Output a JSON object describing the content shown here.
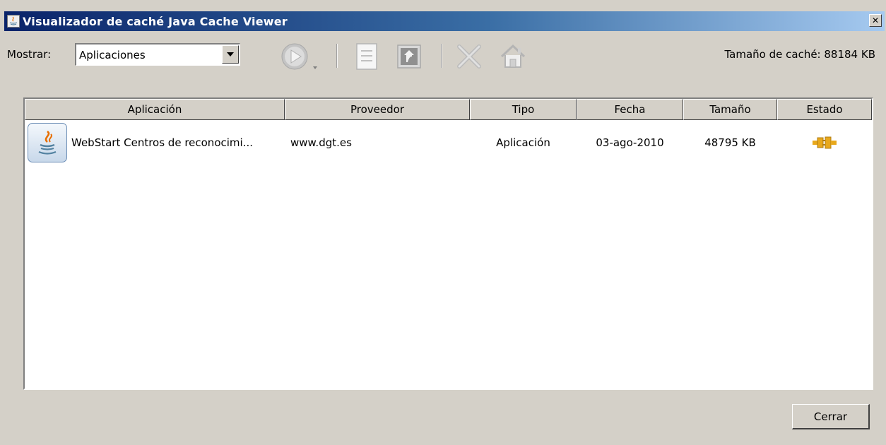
{
  "window": {
    "title": "Visualizador de caché Java Cache Viewer",
    "close_glyph": "✕"
  },
  "toolbar": {
    "mostrar_label": "Mostrar:",
    "view_select_value": "Aplicaciones",
    "cache_size_text": "Tamaño de caché: 88184 KB",
    "icons": [
      "run-icon",
      "info-document-icon",
      "create-shortcut-icon",
      "delete-icon",
      "home-icon"
    ]
  },
  "table": {
    "columns": [
      "Aplicación",
      "Proveedor",
      "Tipo",
      "Fecha",
      "Tamaño",
      "Estado"
    ],
    "rows": [
      {
        "app": "WebStart Centros de reconocimi...",
        "vendor": "www.dgt.es",
        "type": "Aplicación",
        "date": "03-ago-2010",
        "size": "48795 KB",
        "status_icon": "plug-connected-icon"
      }
    ]
  },
  "footer": {
    "close_label": "Cerrar"
  },
  "colors": {
    "titlebar_start": "#0a246a",
    "titlebar_end": "#a6caf0",
    "window_bg": "#d4d0c8",
    "status_icon": "#e8a81c"
  }
}
